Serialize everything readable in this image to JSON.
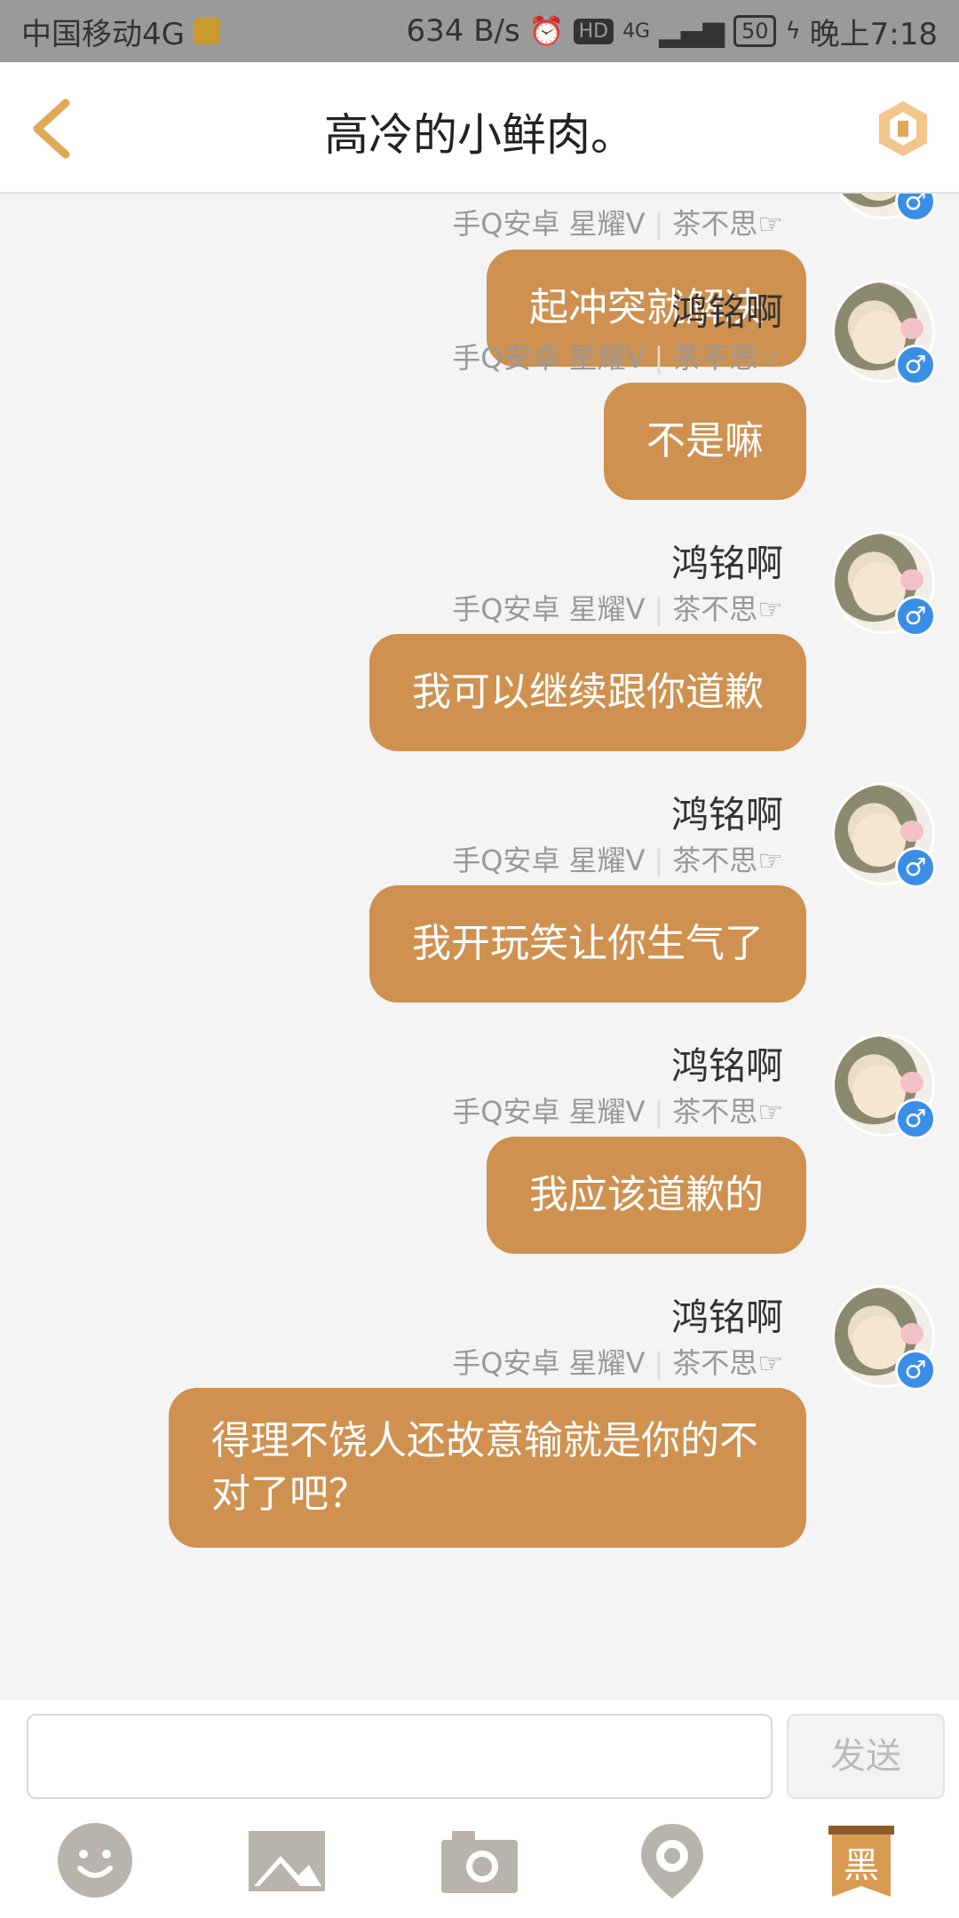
{
  "status_bar": {
    "carrier": "中国移动4G",
    "net_speed": "634 B/s",
    "network": "4G",
    "battery": "50",
    "time": "晚上7:18"
  },
  "header": {
    "title": "高冷的小鲜肉。"
  },
  "messages": [
    {
      "name": "",
      "meta_left": "手Q安卓 星耀V",
      "meta_right": "茶不思☞",
      "text": "起冲突就解决"
    },
    {
      "name": "鸿铭啊",
      "meta_left": "手Q安卓 星耀V",
      "meta_right": "茶不思☞",
      "text": "不是嘛"
    },
    {
      "name": "鸿铭啊",
      "meta_left": "手Q安卓 星耀V",
      "meta_right": "茶不思☞",
      "text": "我可以继续跟你道歉"
    },
    {
      "name": "鸿铭啊",
      "meta_left": "手Q安卓 星耀V",
      "meta_right": "茶不思☞",
      "text": "我开玩笑让你生气了"
    },
    {
      "name": "鸿铭啊",
      "meta_left": "手Q安卓 星耀V",
      "meta_right": "茶不思☞",
      "text": "我应该道歉的"
    },
    {
      "name": "鸿铭啊",
      "meta_left": "手Q安卓 星耀V",
      "meta_right": "茶不思☞",
      "text": "得理不饶人还故意输就是你的不对了吧？"
    }
  ],
  "input": {
    "placeholder": "",
    "send_label": "发送"
  },
  "toolbar": {
    "items": [
      "emoji-icon",
      "image-icon",
      "camera-icon",
      "location-icon",
      "blacklist-icon"
    ],
    "black_label": "黑"
  },
  "colors": {
    "bubble": "#cf9150",
    "accent": "#e0a85a",
    "gender_badge": "#3a8ee6"
  }
}
